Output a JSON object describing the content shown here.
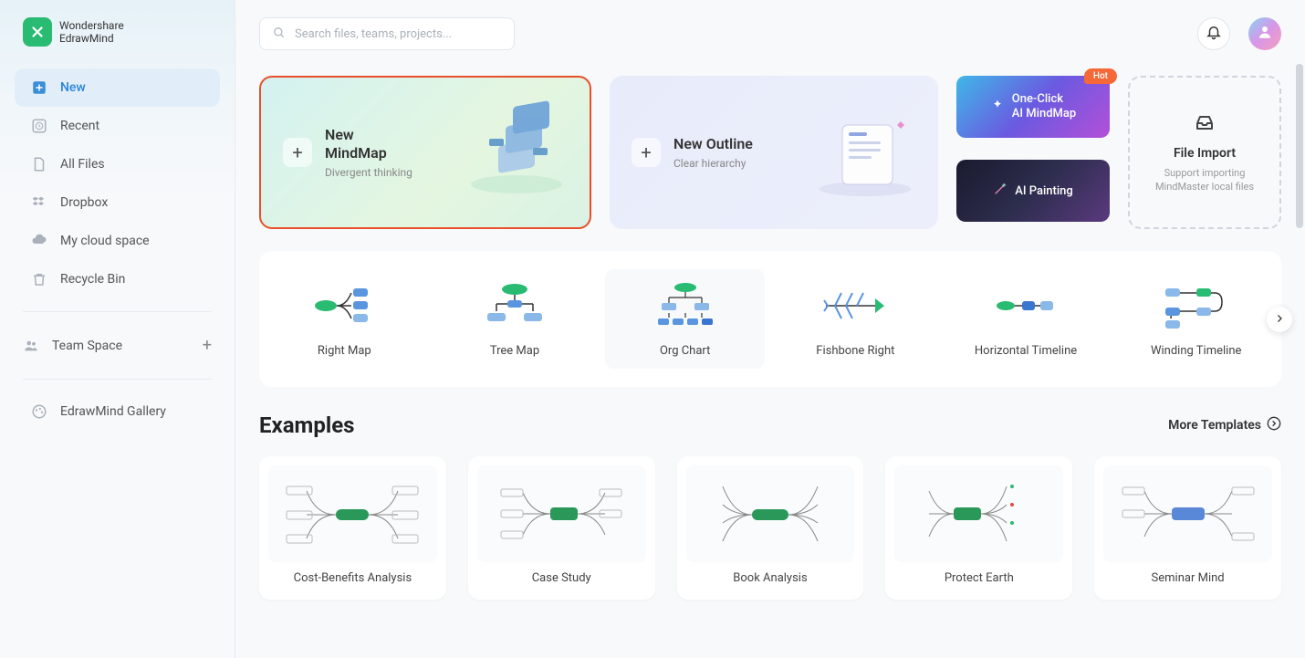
{
  "app": {
    "brand1": "Wondershare",
    "brand2": "EdrawMind"
  },
  "sidebar": {
    "items": [
      {
        "label": "New"
      },
      {
        "label": "Recent"
      },
      {
        "label": "All Files"
      },
      {
        "label": "Dropbox"
      },
      {
        "label": "My cloud space"
      },
      {
        "label": "Recycle Bin"
      }
    ],
    "team_space": "Team Space",
    "gallery": "EdrawMind Gallery"
  },
  "search": {
    "placeholder": "Search files, teams, projects..."
  },
  "cards": {
    "mindmap": {
      "title1": "New",
      "title2": "MindMap",
      "sub": "Divergent thinking"
    },
    "outline": {
      "title": "New Outline",
      "sub": "Clear hierarchy"
    },
    "ai_mindmap": {
      "line1": "One-Click",
      "line2": "AI MindMap",
      "badge": "Hot"
    },
    "ai_painting": "AI Painting",
    "import": {
      "title": "File Import",
      "sub": "Support importing MindMaster local files"
    }
  },
  "templates": [
    {
      "label": "Right Map"
    },
    {
      "label": "Tree Map"
    },
    {
      "label": "Org Chart"
    },
    {
      "label": "Fishbone Right"
    },
    {
      "label": "Horizontal Timeline"
    },
    {
      "label": "Winding Timeline"
    }
  ],
  "examples": {
    "heading": "Examples",
    "more": "More Templates",
    "items": [
      {
        "label": "Cost-Benefits Analysis"
      },
      {
        "label": "Case Study"
      },
      {
        "label": "Book Analysis"
      },
      {
        "label": "Protect Earth"
      },
      {
        "label": "Seminar Mind"
      }
    ]
  }
}
